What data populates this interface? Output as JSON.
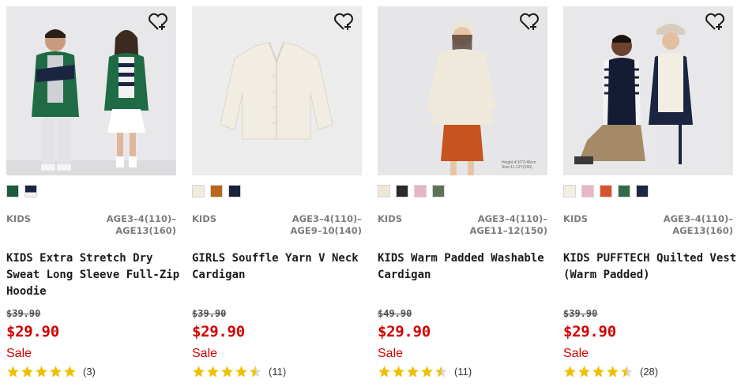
{
  "products": [
    {
      "gender": "KIDS",
      "age": "AGE3–4(110)–AGE13(160)",
      "name": "KIDS Extra Stretch Dry Sweat Long Sleeve Full-Zip Hoodie",
      "original_price": "$39.90",
      "price": "$29.90",
      "flag": "Sale",
      "rating": 5,
      "review_count": "(3)",
      "colors": [
        "#1c5b40",
        "#1b2540"
      ]
    },
    {
      "gender": "KIDS",
      "age": "AGE3–4(110)–AGE9–10(140)",
      "name": "GIRLS Souffle Yarn V Neck Cardigan",
      "original_price": "$39.90",
      "price": "$29.90",
      "flag": "Sale",
      "rating": 4.5,
      "review_count": "(11)",
      "colors": [
        "#f0ebde",
        "#b9661e",
        "#1a2238"
      ]
    },
    {
      "gender": "KIDS",
      "age": "AGE3–4(110)–AGE11–12(150)",
      "name": "KIDS Warm Padded Washable Cardigan",
      "original_price": "$49.90",
      "price": "$29.90",
      "flag": "Sale",
      "rating": 4.5,
      "review_count": "(11)",
      "colors": [
        "#ede7d6",
        "#2a2a2a",
        "#e6b4c4",
        "#5f7257"
      ]
    },
    {
      "gender": "KIDS",
      "age": "AGE3–4(110)–AGE13(160)",
      "name": "KIDS PUFFTECH Quilted Vest (Warm Padded)",
      "original_price": "$39.90",
      "price": "$29.90",
      "flag": "Sale",
      "rating": 4.5,
      "review_count": "(28)",
      "colors": [
        "#f2eee3",
        "#e9b6c5",
        "#d9522e",
        "#2f6a4a",
        "#1c2744"
      ]
    }
  ],
  "image_captions": {
    "product_3": "Height:4'10\"/148cm Size:11-12Y(150)"
  },
  "accent_colors": {
    "sale_red": "#d30000",
    "star_gold": "#f0c000"
  },
  "icons": {
    "favorite": "heart-plus-icon",
    "rating": "star-icon"
  }
}
